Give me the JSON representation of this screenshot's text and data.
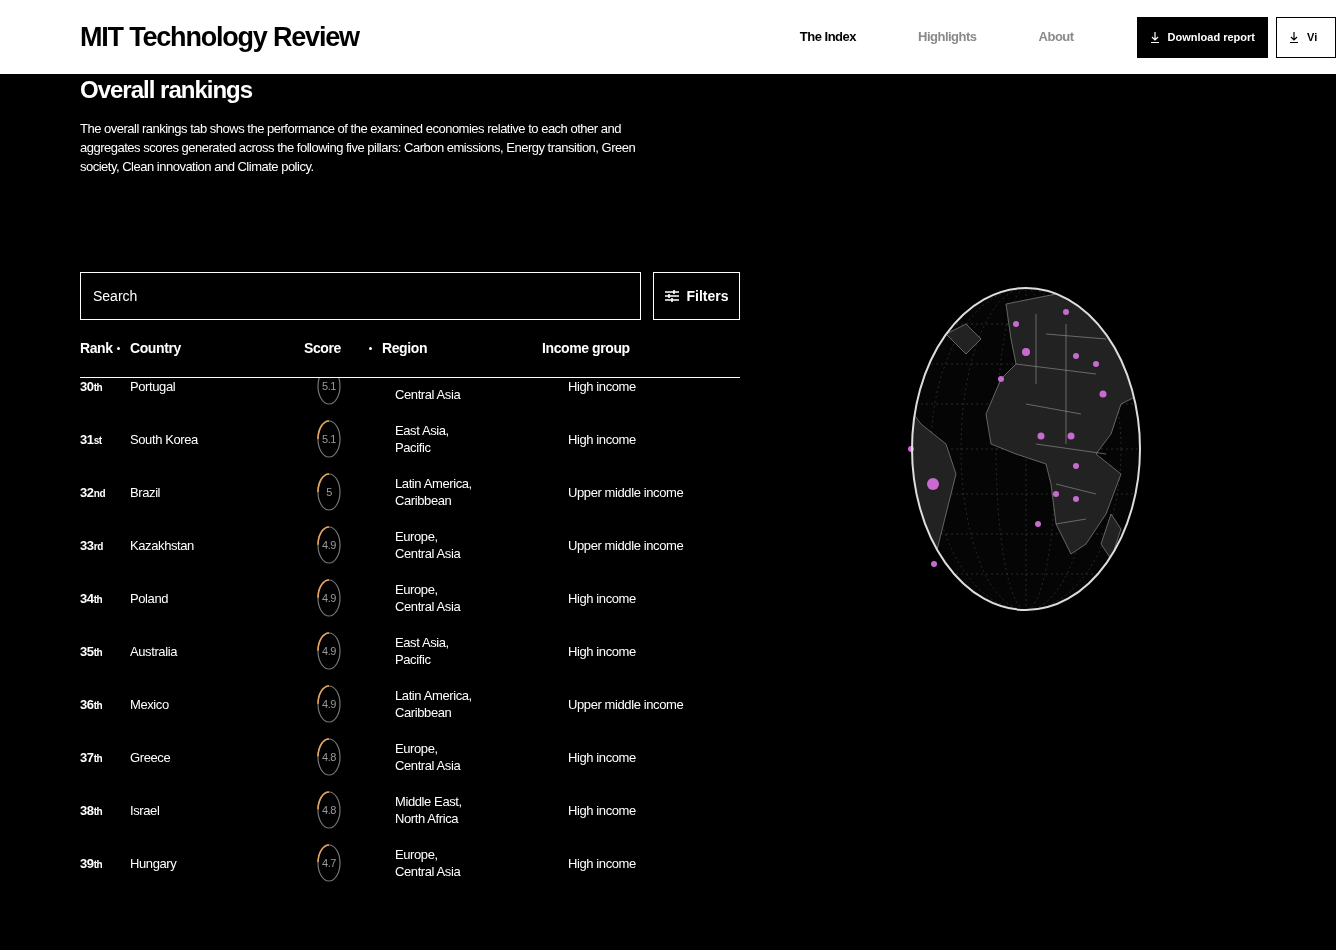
{
  "header": {
    "logo": "MIT Technology Review",
    "nav": [
      {
        "label": "The Index",
        "selected": true
      },
      {
        "label": "Highlights",
        "selected": false
      },
      {
        "label": "About",
        "selected": false
      }
    ],
    "buttons": [
      {
        "label": "Download report",
        "kind": "solid"
      },
      {
        "label": "Vi",
        "kind": "outline"
      }
    ]
  },
  "section": {
    "heading": "Overall rankings",
    "intro": "The overall rankings tab shows the performance of the examined economies relative to each other and aggregates scores generated across the following five pillars: Carbon emissions, Energy transition, Green society, Clean innovation and Climate policy."
  },
  "search": {
    "placeholder": "Search"
  },
  "filters_button": "Filters",
  "table": {
    "columns": [
      {
        "label": "Rank",
        "sortable": false
      },
      {
        "label": "Country",
        "sortable": true
      },
      {
        "label": "Score",
        "sortable": false
      },
      {
        "label": "Region",
        "sortable": true
      },
      {
        "label": "Income group",
        "sortable": false
      }
    ],
    "rows": [
      {
        "rank": "30th",
        "country": "Portugal",
        "score": "5.1",
        "region": [
          "Central Asia"
        ],
        "income": "High income"
      },
      {
        "rank": "31st",
        "country": "South Korea",
        "score": "5.1",
        "level": 0.51,
        "region": [
          "East Asia,",
          "Pacific"
        ],
        "income": "High income"
      },
      {
        "rank": "32nd",
        "country": "Brazil",
        "score": "5",
        "level": 0.5,
        "region": [
          "Latin America,",
          "Caribbean"
        ],
        "income": "Upper middle income"
      },
      {
        "rank": "33rd",
        "country": "Kazakhstan",
        "score": "4.9",
        "level": 0.49,
        "region": [
          "Europe,",
          "Central Asia"
        ],
        "income": "Upper middle income"
      },
      {
        "rank": "34th",
        "country": "Poland",
        "score": "4.9",
        "level": 0.49,
        "region": [
          "Europe,",
          "Central Asia"
        ],
        "income": "High income"
      },
      {
        "rank": "35th",
        "country": "Australia",
        "score": "4.9",
        "level": 0.49,
        "region": [
          "East Asia,",
          "Pacific"
        ],
        "income": "High income"
      },
      {
        "rank": "36th",
        "country": "Mexico",
        "score": "4.9",
        "level": 0.49,
        "region": [
          "Latin America,",
          "Caribbean"
        ],
        "income": "Upper middle income"
      },
      {
        "rank": "37th",
        "country": "Greece",
        "score": "4.8",
        "level": 0.48,
        "region": [
          "Europe,",
          "Central Asia"
        ],
        "income": "High income"
      },
      {
        "rank": "38th",
        "country": "Israel",
        "score": "4.8",
        "level": 0.48,
        "region": [
          "Middle East,",
          "North Africa"
        ],
        "income": "High income"
      },
      {
        "rank": "39th",
        "country": "Hungary",
        "score": "4.7",
        "level": 0.47,
        "region": [
          "Europe,",
          "Central Asia"
        ],
        "income": "High income"
      }
    ]
  }
}
